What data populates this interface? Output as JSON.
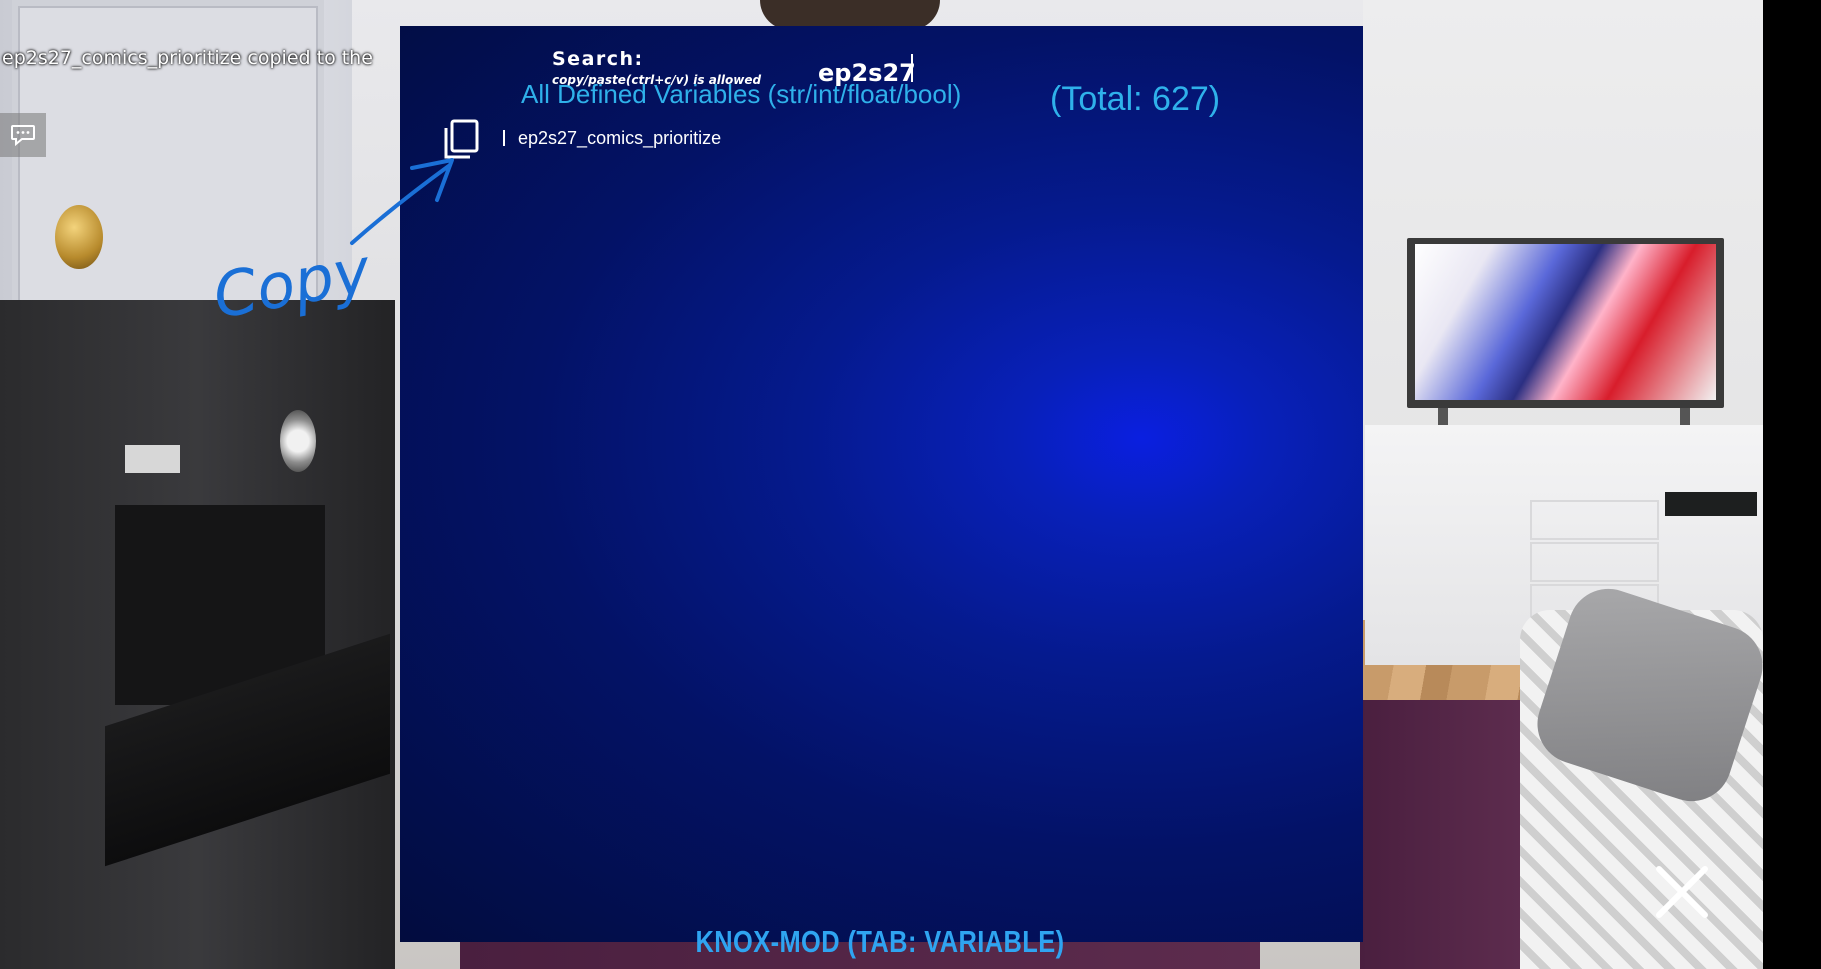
{
  "notification": {
    "text": "ep2s27_comics_prioritize copied to the"
  },
  "mod_panel": {
    "search": {
      "label": "Search:",
      "hint": "copy/paste(ctrl+c/v) is allowed",
      "value": "ep2s27"
    },
    "title": "All Defined Variables (str/int/float/bool)",
    "total": "(Total: 627)",
    "results": [
      {
        "name": "ep2s27_comics_prioritize"
      }
    ],
    "footer": "KNOX-MOD (TAB: VARIABLE)"
  },
  "annotation": {
    "text": "Copy"
  },
  "icons": {
    "copy": "copy-icon",
    "chat": "chat-bubble-icon",
    "close": "close-icon"
  },
  "colors": {
    "accent_text": "#2fb1ea",
    "footer_text": "#2fa4f1",
    "annotation_ink": "#1a6fd6",
    "panel_center": "#0a1fe0",
    "panel_edge": "#020c3e"
  }
}
